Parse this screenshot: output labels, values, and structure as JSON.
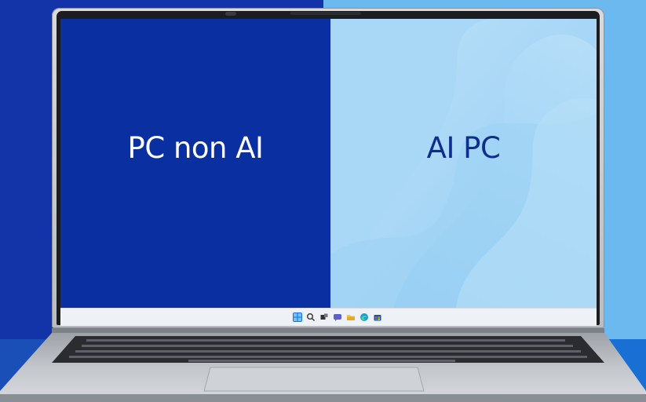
{
  "screen": {
    "left_label": "PC non AI",
    "right_label": "AI PC"
  },
  "taskbar": {
    "icons": [
      "windows-start-icon",
      "search-icon",
      "task-view-icon",
      "chat-icon",
      "file-explorer-icon",
      "edge-browser-icon",
      "store-icon"
    ]
  },
  "colors": {
    "left_background": "#1234a8",
    "right_background": "#6cb9ef",
    "left_screen": "#0a2fa0",
    "right_screen": "#a6d6f6"
  }
}
